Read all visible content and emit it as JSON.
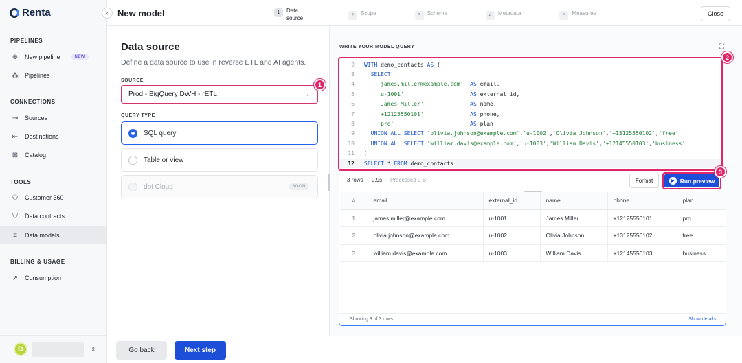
{
  "app": {
    "name": "Renta"
  },
  "sidebar": {
    "sections": [
      {
        "label": "PIPELINES"
      },
      {
        "label": "CONNECTIONS"
      },
      {
        "label": "TOOLS"
      },
      {
        "label": "BILLING & USAGE"
      }
    ],
    "items": [
      {
        "label": "New pipeline",
        "icon": "plus-circle-icon",
        "badge": "NEW"
      },
      {
        "label": "Pipelines",
        "icon": "pipelines-icon"
      },
      {
        "label": "Sources",
        "icon": "source-arrow-icon"
      },
      {
        "label": "Destinations",
        "icon": "destination-arrow-icon"
      },
      {
        "label": "Catalog",
        "icon": "grid-icon"
      },
      {
        "label": "Customer 360",
        "icon": "user-icon"
      },
      {
        "label": "Data contracts",
        "icon": "shield-icon"
      },
      {
        "label": "Data models",
        "icon": "database-icon",
        "active": true
      },
      {
        "label": "Consumption",
        "icon": "chart-icon"
      }
    ],
    "account": {
      "avatar_letter": "D"
    }
  },
  "header": {
    "title": "New model",
    "steps": [
      {
        "num": "1",
        "label": "Data source",
        "active": true
      },
      {
        "num": "2",
        "label": "Scope"
      },
      {
        "num": "3",
        "label": "Schema"
      },
      {
        "num": "4",
        "label": "Metadata"
      },
      {
        "num": "5",
        "label": "Measures"
      }
    ],
    "close_label": "Close"
  },
  "data_source": {
    "title": "Data source",
    "description": "Define a data source to use in reverse ETL and AI agents.",
    "source_label": "SOURCE",
    "source_value": "Prod - BigQuery DWH - rETL",
    "query_type_label": "QUERY TYPE",
    "options": [
      {
        "label": "SQL query",
        "selected": true
      },
      {
        "label": "Table or view"
      },
      {
        "label": "dbt Cloud",
        "disabled": true,
        "badge": "SOON"
      }
    ]
  },
  "markers": [
    "1",
    "2",
    "3"
  ],
  "editor": {
    "label": "WRITE YOUR MODEL QUERY",
    "lines": [
      {
        "n": "2",
        "tokens": [
          [
            "kw",
            "WITH "
          ],
          [
            "plain",
            "demo_contacts "
          ],
          [
            "kw",
            "AS "
          ],
          [
            "plain",
            "("
          ]
        ]
      },
      {
        "n": "3",
        "tokens": [
          [
            "kw",
            "  SELECT"
          ]
        ]
      },
      {
        "n": "4",
        "tokens": [
          [
            "str",
            "    'james.miller@example.com'  "
          ],
          [
            "kw",
            "AS "
          ],
          [
            "plain",
            "email,"
          ]
        ]
      },
      {
        "n": "5",
        "tokens": [
          [
            "str",
            "    'u-1001'                    "
          ],
          [
            "kw",
            "AS "
          ],
          [
            "plain",
            "external_id,"
          ]
        ]
      },
      {
        "n": "6",
        "tokens": [
          [
            "str",
            "    'James Miller'              "
          ],
          [
            "kw",
            "AS "
          ],
          [
            "plain",
            "name,"
          ]
        ]
      },
      {
        "n": "7",
        "tokens": [
          [
            "str",
            "    '+12125550101'              "
          ],
          [
            "kw",
            "AS "
          ],
          [
            "plain",
            "phone,"
          ]
        ]
      },
      {
        "n": "8",
        "tokens": [
          [
            "str",
            "    'pro'                       "
          ],
          [
            "kw",
            "AS "
          ],
          [
            "plain",
            "plan"
          ]
        ]
      },
      {
        "n": "9",
        "tokens": [
          [
            "kw",
            "  UNION ALL SELECT "
          ],
          [
            "str",
            "'olivia.johnson@example.com'"
          ],
          [
            "plain",
            ","
          ],
          [
            "str",
            "'u-1002'"
          ],
          [
            "plain",
            ","
          ],
          [
            "str",
            "'Olivia Johnson'"
          ],
          [
            "plain",
            ","
          ],
          [
            "str",
            "'+13125550102'"
          ],
          [
            "plain",
            ","
          ],
          [
            "str",
            "'free'"
          ]
        ]
      },
      {
        "n": "10",
        "tokens": [
          [
            "kw",
            "  UNION ALL SELECT "
          ],
          [
            "str",
            "'william.davis@example.com'"
          ],
          [
            "plain",
            ","
          ],
          [
            "str",
            "'u-1003'"
          ],
          [
            "plain",
            ","
          ],
          [
            "str",
            "'William Davis'"
          ],
          [
            "plain",
            ","
          ],
          [
            "str",
            "'+12145550103'"
          ],
          [
            "plain",
            ","
          ],
          [
            "str",
            "'business'"
          ]
        ]
      },
      {
        "n": "11",
        "tokens": [
          [
            "plain",
            ")"
          ]
        ]
      },
      {
        "n": "12",
        "tokens": [
          [
            "kw",
            "SELECT "
          ],
          [
            "plain",
            "* "
          ],
          [
            "kw",
            "FROM "
          ],
          [
            "plain",
            "demo_contacts"
          ]
        ],
        "current": true
      }
    ]
  },
  "results": {
    "rows_meta": "3 rows",
    "time_meta": "0.9s",
    "processed_meta": "Processed 0 B",
    "format_label": "Format",
    "run_label": "Run preview",
    "columns": [
      "#",
      "email",
      "external_id",
      "name",
      "phone",
      "plan"
    ],
    "rows": [
      [
        "1",
        "james.miller@example.com",
        "u-1001",
        "James Miller",
        "+12125550101",
        "pro"
      ],
      [
        "2",
        "olivia.johnson@example.com",
        "u-1002",
        "Olivia Johnson",
        "+13125550102",
        "free"
      ],
      [
        "3",
        "william.davis@example.com",
        "u-1003",
        "William Davis",
        "+12145550103",
        "business"
      ]
    ],
    "footer_count": "Showing 3 of 3 rows",
    "show_details": "Show details"
  },
  "footer": {
    "back_label": "Go back",
    "next_label": "Next step"
  },
  "colors": {
    "accent": "#1d4ed8",
    "highlight": "#e0256b"
  }
}
